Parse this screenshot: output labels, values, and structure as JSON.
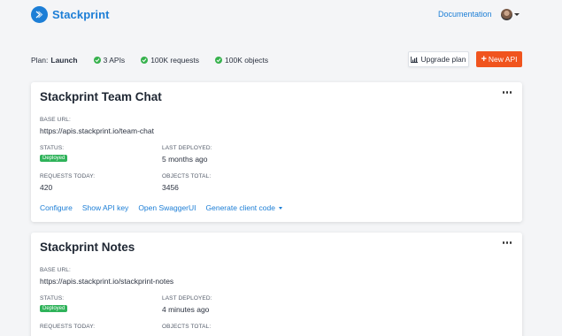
{
  "header": {
    "brand": "Stackprint",
    "documentation_link": "Documentation"
  },
  "plan": {
    "label": "Plan:",
    "name": "Launch",
    "features": [
      "3 APIs",
      "100K requests",
      "100K objects"
    ]
  },
  "buttons": {
    "upgrade": "Upgrade plan",
    "new_api": "New API"
  },
  "cards": [
    {
      "title": "Stackprint Team Chat",
      "base_url_label": "BASE URL:",
      "base_url": "https://apis.stackprint.io/team-chat",
      "status_label": "STATUS:",
      "status": "Deployed",
      "last_deployed_label": "LAST DEPLOYED:",
      "last_deployed": "5 months ago",
      "requests_label": "REQUESTS TODAY:",
      "requests": "420",
      "objects_label": "OBJECTS TOTAL:",
      "objects": "3456",
      "actions": [
        "Configure",
        "Show API key",
        "Open SwaggerUI",
        "Generate client code"
      ]
    },
    {
      "title": "Stackprint Notes",
      "base_url_label": "BASE URL:",
      "base_url": "https://apis.stackprint.io/stackprint-notes",
      "status_label": "STATUS:",
      "status": "Deployed",
      "last_deployed_label": "LAST DEPLOYED:",
      "last_deployed": "4 minutes ago",
      "requests_label": "REQUESTS TODAY:",
      "requests": "",
      "objects_label": "OBJECTS TOTAL:",
      "objects": ""
    }
  ],
  "colors": {
    "brand": "#1c7ed6",
    "accent": "#f0541e",
    "success": "#37b24d"
  }
}
